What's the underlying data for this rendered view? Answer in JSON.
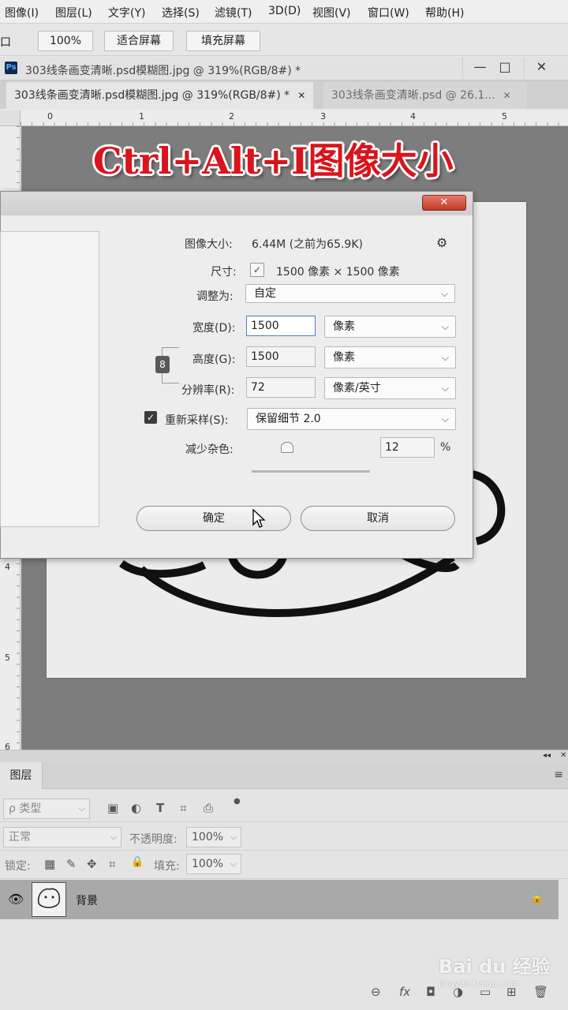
{
  "menu": [
    "图像(I)",
    "图层(L)",
    "文字(Y)",
    "选择(S)",
    "滤镜(T)",
    "3D(D)",
    "视图(V)",
    "窗口(W)",
    "帮助(H)"
  ],
  "options_bar": {
    "edge_label": "口",
    "zoom_button": "100%",
    "fit_screen_button": "适合屏幕",
    "fill_screen_button": "填充屏幕"
  },
  "document_window": {
    "app_icon_text": "Ps",
    "title": "303线条画变清晰.psd模糊图.jpg @ 319%(RGB/8#) *",
    "minimize": "—",
    "maximize": "□",
    "close": "✕"
  },
  "tabs": [
    {
      "label": "303线条画变清晰.psd模糊图.jpg @ 319%(RGB/8#) *",
      "close": "✕"
    },
    {
      "label": "303线条画变清晰.psd @ 26.1...",
      "close": "✕"
    }
  ],
  "ruler": {
    "h_numbers": [
      "0",
      "1",
      "2",
      "3",
      "4",
      "5"
    ],
    "v_numbers": [
      "4",
      "5",
      "6"
    ]
  },
  "overlay_title": "Ctrl+Alt+I图像大小",
  "image_size_dialog": {
    "close_button": "✕",
    "image_size_label": "图像大小:",
    "image_size_value": "6.44M (之前为65.9K)",
    "settings_icon": "⚙",
    "dimensions_label": "尺寸:",
    "dimensions_toggle": "✓",
    "dimensions_value": "1500 像素  ×  1500 像素",
    "fit_to_label": "调整为:",
    "fit_to_value": "自定",
    "width_label": "宽度(D):",
    "width_value": "1500",
    "width_unit": "像素",
    "height_label": "高度(G):",
    "height_value": "1500",
    "height_unit": "像素",
    "resolution_label": "分辨率(R):",
    "resolution_value": "72",
    "resolution_unit": "像素/英寸",
    "resample_checked": "✓",
    "resample_label": "重新采样(S):",
    "resample_value": "保留细节 2.0",
    "reduce_noise_label": "减少杂色:",
    "reduce_noise_value": "12",
    "reduce_noise_unit": "%",
    "ok_button": "确定",
    "cancel_button": "取消",
    "link_icon": "8"
  },
  "layers_panel": {
    "collapse_icon": "◂◂",
    "close_icon": "✕",
    "tab_label": "图层",
    "menu_icon": "≡",
    "filter_kind": "ρ 类型",
    "filter_icons": [
      "▣",
      "◐",
      "T",
      "⌗",
      "⎙"
    ],
    "blend_mode": "正常",
    "opacity_label": "不透明度:",
    "opacity_value": "100%",
    "lock_label": "锁定:",
    "lock_icons": [
      "▦",
      "✎",
      "✥",
      "⌗",
      "🔒"
    ],
    "fill_label": "填充:",
    "fill_value": "100%",
    "layer_name": "背景",
    "bottom_icons": [
      "⊖",
      "fx",
      "◘",
      "◑",
      "▭",
      "⊞",
      "🗑"
    ]
  },
  "watermark": {
    "main": "Bai du 经验",
    "sub": "jingyan.baidu.com"
  }
}
